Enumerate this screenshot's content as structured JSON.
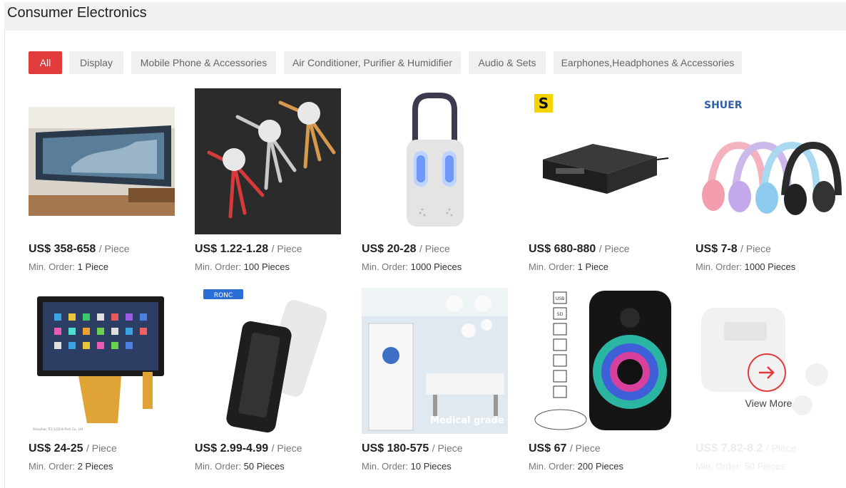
{
  "header": {
    "title": "Consumer Electronics"
  },
  "tabs": [
    {
      "label": "All",
      "active": true
    },
    {
      "label": "Display"
    },
    {
      "label": "Mobile Phone & Accessories"
    },
    {
      "label": "Air Conditioner, Purifier & Humidifier"
    },
    {
      "label": "Audio & Sets"
    },
    {
      "label": "Earphones,Headphones & Accessories"
    }
  ],
  "products": [
    {
      "price": "US$ 358-658",
      "unit": "/ Piece",
      "moq_label": "Min. Order:",
      "moq": "1 Piece",
      "image": "led-display-wall"
    },
    {
      "price": "US$ 1.22-1.28",
      "unit": "/ Piece",
      "moq_label": "Min. Order:",
      "moq": "100 Pieces",
      "image": "retractable-charging-cables"
    },
    {
      "price": "US$ 20-28",
      "unit": "/ Piece",
      "moq_label": "Min. Order:",
      "moq": "1000 Pieces",
      "image": "uv-air-purifier-lamp"
    },
    {
      "price": "US$ 680-880",
      "unit": "/ Piece",
      "moq_label": "Min. Order:",
      "moq": "1 Piece",
      "image": "power-amplifier",
      "brand_mark": "S"
    },
    {
      "price": "US$ 7-8",
      "unit": "/ Piece",
      "moq_label": "Min. Order:",
      "moq": "1000 Pieces",
      "image": "cat-ear-headphones",
      "brand": "SHUER"
    },
    {
      "price": "US$ 24-25",
      "unit": "/ Piece",
      "moq_label": "Min. Order:",
      "moq": "2 Pieces",
      "image": "touch-lcd-panel",
      "caption": "Shenzhen TCC LCD Hi-Tech Co., Ltd"
    },
    {
      "price": "US$ 2.99-4.99",
      "unit": "/ Piece",
      "moq_label": "Min. Order:",
      "moq": "50 Pieces",
      "image": "power-bank",
      "brand": "RONC"
    },
    {
      "price": "US$ 180-575",
      "unit": "/ Piece",
      "moq_label": "Min. Order:",
      "moq": "10 Pieces",
      "image": "medical-air-purifier",
      "caption": "Medical grade"
    },
    {
      "price": "US$ 67",
      "unit": "/ Piece",
      "moq_label": "Min. Order:",
      "moq": "200 Pieces",
      "image": "rgb-party-speaker",
      "feature_icons": [
        "USB",
        "SD"
      ]
    },
    {
      "price": "US$ 7.82-8.2",
      "unit": "/ Piece",
      "moq_label": "Min. Order:",
      "moq": "50 Pieces",
      "image": "earbuds-case"
    }
  ],
  "view_more": {
    "label": "View More"
  },
  "colors": {
    "accent": "#e23b3b",
    "tab_bg": "#f0f0f0",
    "header_bg": "#f0f1f3"
  }
}
